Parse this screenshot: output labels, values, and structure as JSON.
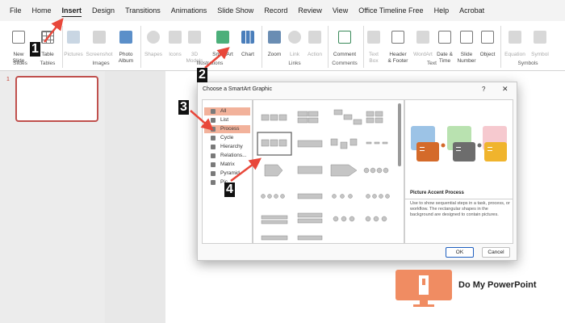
{
  "ribbon_tabs": [
    "File",
    "Home",
    "Insert",
    "Design",
    "Transitions",
    "Animations",
    "Slide Show",
    "Record",
    "Review",
    "View",
    "Office Timeline Free",
    "Help",
    "Acrobat"
  ],
  "ribbon": {
    "new_slide": "New\nSlide",
    "table": "Table",
    "pictures": "Pictures",
    "screenshot": "Screenshot",
    "photo_album": "Photo\nAlbum",
    "shapes": "Shapes",
    "icons": "Icons",
    "3d_models": "3D\nModels",
    "smartart": "SmartArt",
    "chart": "Chart",
    "zoom": "Zoom",
    "link": "Link",
    "action": "Action",
    "comment": "Comment",
    "text_box": "Text\nBox",
    "header_footer": "Header\n& Footer",
    "wordart": "WordArt",
    "date_time": "Date &\nTime",
    "slide_number": "Slide\nNumber",
    "object": "Object",
    "equation": "Equation",
    "symbol": "Symbol",
    "groups": {
      "slides": "Slides",
      "tables": "Tables",
      "images": "Images",
      "illustrations": "Illustrations",
      "links": "Links",
      "comments": "Comments",
      "text": "Text",
      "symbols": "Symbols"
    }
  },
  "slides_pane": {
    "thumb_number": "1"
  },
  "dialog": {
    "title": "Choose a SmartArt Graphic",
    "help": "?",
    "close": "✕",
    "categories": [
      "All",
      "List",
      "Process",
      "Cycle",
      "Hierarchy",
      "Relations...",
      "Matrix",
      "Pyramid",
      "Pic..."
    ],
    "selected_category": "Process",
    "preview_title": "Picture Accent Process",
    "preview_description": "Use to show sequential steps in a task, process, or workflow. The rectangular shapes in the background are designed to contain pictures.",
    "ok_label": "OK",
    "cancel_label": "Cancel"
  },
  "annotations": [
    "1",
    "2",
    "3",
    "4"
  ],
  "watermark": {
    "brand": "Do My PowerPoint"
  },
  "colors": {
    "accent": "#c0504d",
    "selection": "#f2b29b",
    "arrow": "#e8473a",
    "logo": "#f08c62"
  }
}
